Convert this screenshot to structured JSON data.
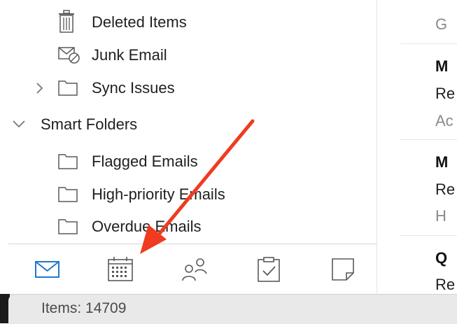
{
  "sidebar": {
    "folders": [
      {
        "label": "Deleted Items",
        "icon": "trash-icon"
      },
      {
        "label": "Junk Email",
        "icon": "junk-icon"
      },
      {
        "label": "Sync Issues",
        "icon": "folder-icon",
        "expandable": true
      }
    ],
    "smart_folders": {
      "label": "Smart Folders",
      "expanded": true,
      "items": [
        {
          "label": "Flagged Emails",
          "icon": "folder-icon"
        },
        {
          "label": "High-priority Emails",
          "icon": "folder-icon"
        },
        {
          "label": "Overdue Emails",
          "icon": "folder-icon"
        }
      ]
    }
  },
  "bottom_nav": [
    {
      "name": "mail",
      "icon": "mail-icon",
      "active": true
    },
    {
      "name": "calendar",
      "icon": "calendar-icon",
      "active": false
    },
    {
      "name": "people",
      "icon": "people-icon",
      "active": false
    },
    {
      "name": "tasks",
      "icon": "tasks-icon",
      "active": false
    },
    {
      "name": "notes",
      "icon": "notes-icon",
      "active": false
    }
  ],
  "status_bar": {
    "items_text": "Items: 14709"
  },
  "message_list_peek": {
    "rows": [
      {
        "lines": [
          "G"
        ]
      },
      {
        "lines": [
          "M",
          "Re",
          "Ac"
        ]
      },
      {
        "lines": [
          "M",
          "Re",
          "H"
        ]
      },
      {
        "lines": [
          "Q",
          "Re"
        ]
      }
    ]
  },
  "colors": {
    "accent": "#1f78d1",
    "annotation_arrow": "#f03b20"
  }
}
